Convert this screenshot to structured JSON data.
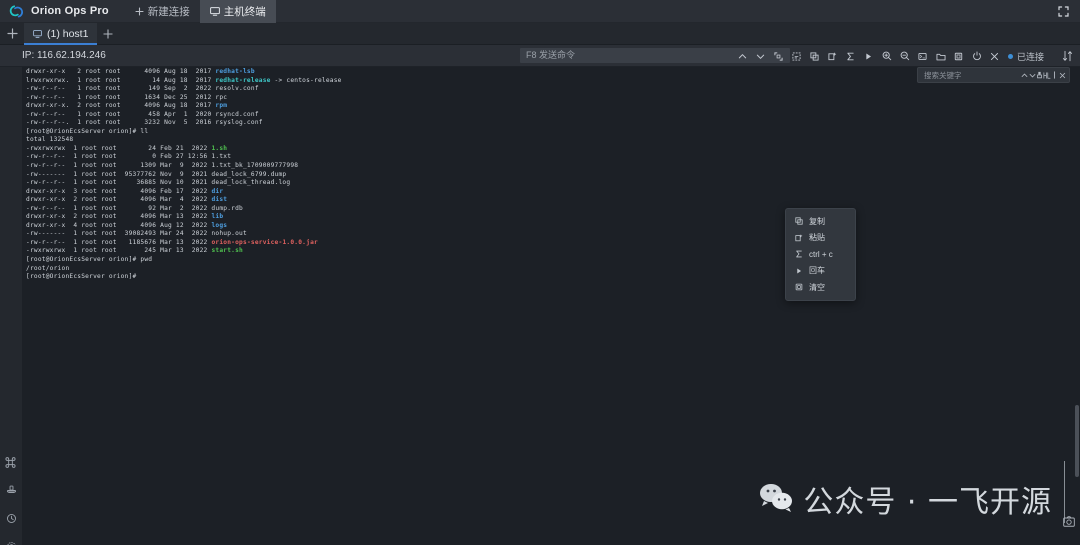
{
  "app": {
    "brand": "Orion Ops Pro",
    "nav": [
      {
        "label": "新建连接",
        "icon": "plus-icon",
        "active": false
      },
      {
        "label": "主机终端",
        "icon": "monitor-icon",
        "active": true
      }
    ],
    "window_controls": [
      {
        "name": "fullscreen-icon"
      },
      {
        "name": "close-icon"
      },
      {
        "name": "code-icon"
      }
    ]
  },
  "tabs": {
    "add_left_label": "+",
    "items": [
      {
        "label": "(1) host1",
        "icon": "monitor-icon",
        "active": true
      }
    ],
    "add_right_label": "+"
  },
  "toolbar": {
    "ip_label": "IP: 116.62.194.246",
    "command_placeholder": "F8 发送命令",
    "command_value": "",
    "icons": [
      "chevron-up-icon",
      "chevron-down-icon",
      "fullscreen-icon",
      "select-all-icon",
      "copy-icon",
      "paste-icon",
      "sigma-icon",
      "play-icon",
      "zoom-in-icon",
      "zoom-out-icon",
      "terminal-icon",
      "folder-icon",
      "trash-icon",
      "power-icon",
      "close-icon"
    ],
    "status_text": "已连接",
    "status_color": "#3d8fd6",
    "sort_icon": "sort-icon"
  },
  "find": {
    "placeholder": "搜索关键字",
    "value": "",
    "icons": [
      "chevron-up-icon",
      "chevron-down-icon",
      "highlight-icon",
      "case-icon",
      "regex-icon",
      "close-icon"
    ]
  },
  "rail": {
    "items": [
      {
        "name": "key-icon"
      },
      {
        "name": "history-icon"
      },
      {
        "name": "settings-icon"
      }
    ]
  },
  "context_menu": {
    "items": [
      {
        "label": "复制",
        "icon": "copy-icon"
      },
      {
        "label": "粘贴",
        "icon": "paste-icon"
      },
      {
        "label": "ctrl + c",
        "icon": "sigma-icon"
      },
      {
        "label": "回车",
        "icon": "play-icon"
      },
      {
        "label": "清空",
        "icon": "trash-icon"
      }
    ]
  },
  "terminal": {
    "lines": [
      [
        {
          "t": "drwxr-xr-x   2 root root      4096 Aug 18  2017 ",
          "c": "def"
        },
        {
          "t": "redhat-lsb",
          "c": "dir"
        }
      ],
      [
        {
          "t": "lrwxrwxrwx.  1 root root        14 Aug 18  2017 ",
          "c": "def"
        },
        {
          "t": "redhat-release",
          "c": "link"
        },
        {
          "t": " -> centos-release",
          "c": "def"
        }
      ],
      [
        {
          "t": "-rw-r--r--   1 root root       149 Sep  2  2022 resolv.conf",
          "c": "def"
        }
      ],
      [
        {
          "t": "-rw-r--r--   1 root root      1634 Dec 25  2012 rpc",
          "c": "def"
        }
      ],
      [
        {
          "t": "drwxr-xr-x.  2 root root      4096 Aug 18  2017 ",
          "c": "def"
        },
        {
          "t": "rpm",
          "c": "dir"
        }
      ],
      [
        {
          "t": "-rw-r--r--   1 root root       458 Apr  1  2020 rsyncd.conf",
          "c": "def"
        }
      ],
      [
        {
          "t": "-rw-r--r--.  1 root root      3232 Nov  5  2016 rsyslog.conf",
          "c": "def"
        }
      ],
      [
        {
          "t": "[root@OrionEcsServer orion]# ll",
          "c": "prompt"
        }
      ],
      [
        {
          "t": "total 132548",
          "c": "def"
        }
      ],
      [
        {
          "t": "-rwxrwxrwx  1 root root        24 Feb 21  2022 ",
          "c": "def"
        },
        {
          "t": "1.sh",
          "c": "exe"
        }
      ],
      [
        {
          "t": "-rw-r--r--  1 root root         0 Feb 27 12:56 1.txt",
          "c": "def"
        }
      ],
      [
        {
          "t": "-rw-r--r--  1 root root      1309 Mar  9  2022 1.txt_bk_1709009777998",
          "c": "def"
        }
      ],
      [
        {
          "t": "-rw-------  1 root root  95377762 Nov  9  2021 dead_lock_6799.dump",
          "c": "def"
        }
      ],
      [
        {
          "t": "-rw-r--r--  1 root root     36885 Nov 10  2021 dead_lock_thread.log",
          "c": "def"
        }
      ],
      [
        {
          "t": "drwxr-xr-x  3 root root      4096 Feb 17  2022 ",
          "c": "def"
        },
        {
          "t": "dir",
          "c": "dir"
        }
      ],
      [
        {
          "t": "drwxr-xr-x  2 root root      4096 Mar  4  2022 ",
          "c": "def"
        },
        {
          "t": "dist",
          "c": "dir"
        }
      ],
      [
        {
          "t": "-rw-r--r--  1 root root        92 Mar  2  2022 dump.rdb",
          "c": "def"
        }
      ],
      [
        {
          "t": "drwxr-xr-x  2 root root      4096 Mar 13  2022 ",
          "c": "def"
        },
        {
          "t": "lib",
          "c": "dir"
        }
      ],
      [
        {
          "t": "drwxr-xr-x  4 root root      4096 Aug 12  2022 ",
          "c": "def"
        },
        {
          "t": "logs",
          "c": "dir"
        }
      ],
      [
        {
          "t": "-rw-------  1 root root  39082493 Mar 24  2022 nohup.out",
          "c": "def"
        }
      ],
      [
        {
          "t": "-rw-r--r--  1 root root   1185676 Mar 13  2022 ",
          "c": "def"
        },
        {
          "t": "orion-ops-service-1.0.0.jar",
          "c": "arch"
        }
      ],
      [
        {
          "t": "-rwxrwxrwx  1 root root       245 Mar 13  2022 ",
          "c": "def"
        },
        {
          "t": "start.sh",
          "c": "exe"
        }
      ],
      [
        {
          "t": "[root@OrionEcsServer orion]# pwd",
          "c": "prompt"
        }
      ],
      [
        {
          "t": "/root/orion",
          "c": "def"
        }
      ],
      [
        {
          "t": "[root@OrionEcsServer orion]#",
          "c": "prompt"
        }
      ]
    ]
  },
  "watermark": {
    "text": "公众号 · 一飞开源",
    "icon": "wechat-icon",
    "screenshot_icon": "camera-icon"
  },
  "colors": {
    "accent": "#3b7fd4",
    "dir": "#4e9fe0",
    "link": "#3fc7c7",
    "exe": "#4fc04f",
    "archive": "#e0615f",
    "terminal_bg": "#1c2026"
  }
}
